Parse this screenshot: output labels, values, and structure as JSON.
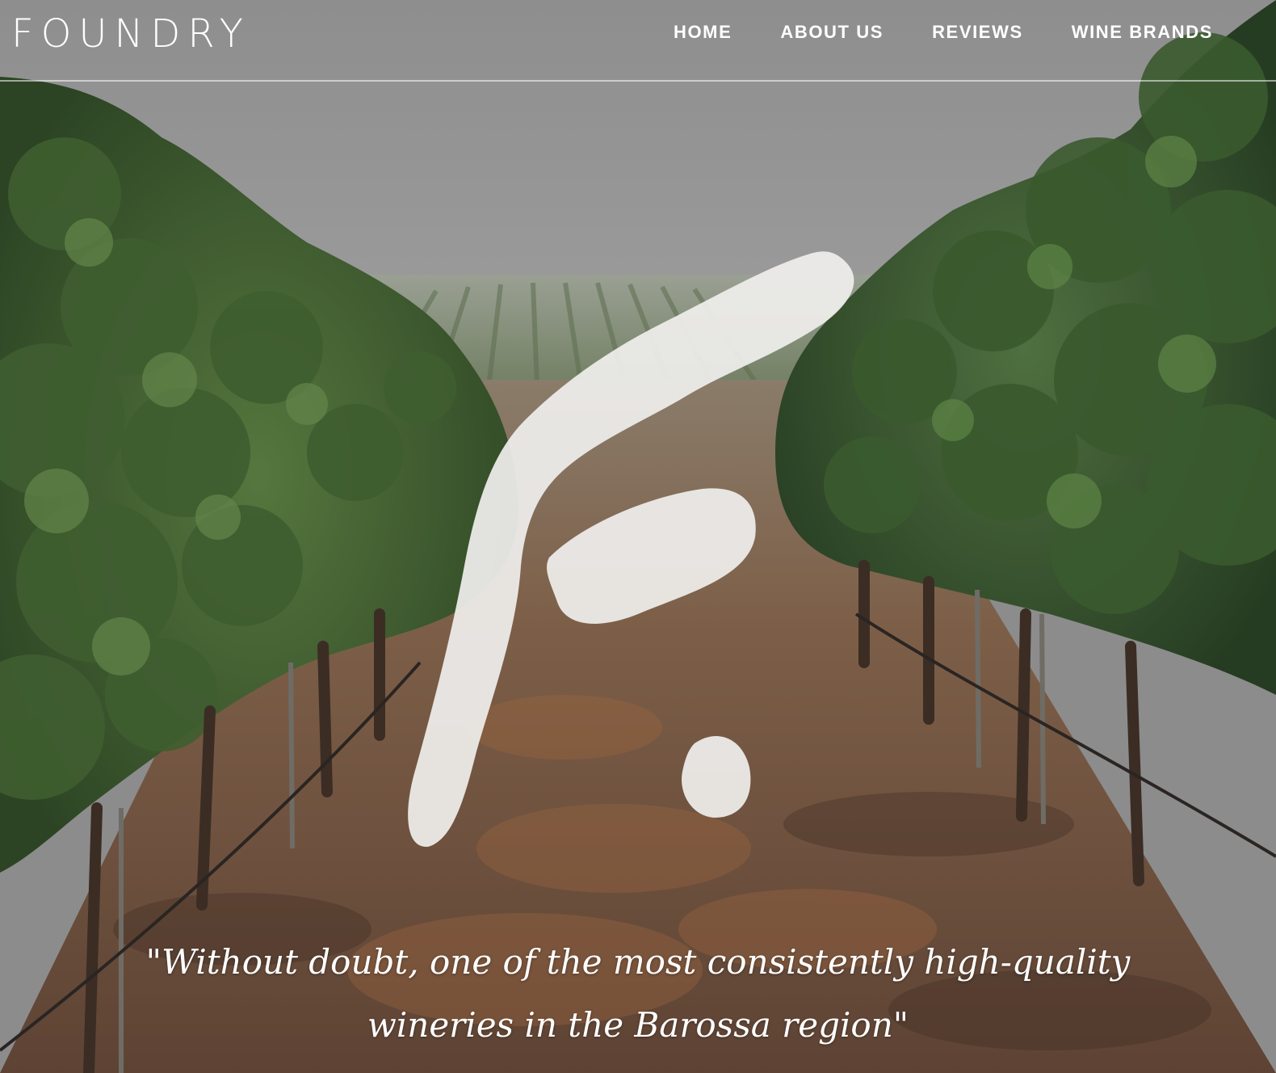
{
  "brand": {
    "logo_text": "FOUNDRY",
    "brush_mark": "f."
  },
  "nav": {
    "items": [
      {
        "label": "HOME"
      },
      {
        "label": "ABOUT US"
      },
      {
        "label": "REVIEWS"
      },
      {
        "label": "WINE BRANDS"
      }
    ]
  },
  "hero": {
    "quote_line1": "\"Without doubt, one of the most consistently high-quality",
    "quote_line2": "wineries in the Barossa region\""
  },
  "colors": {
    "sky": "#8f8f8f",
    "foliage_dark": "#2f4a26",
    "foliage_light": "#4f6e3a",
    "soil": "#7a5a45",
    "brush": "#efeeec",
    "text": "#ffffff"
  }
}
